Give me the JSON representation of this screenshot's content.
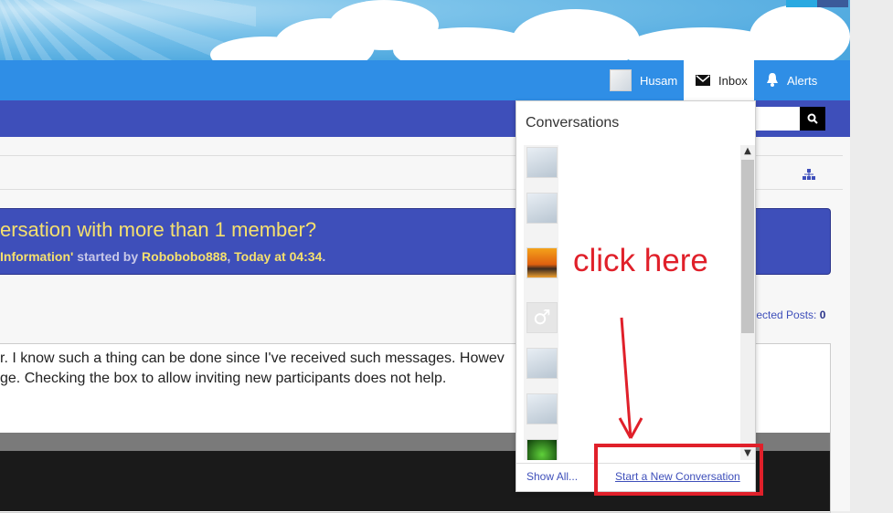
{
  "header": {
    "user_name": "Husam",
    "inbox_label": "Inbox",
    "alerts_label": "Alerts"
  },
  "search": {
    "button_icon": "search-icon"
  },
  "thread": {
    "title": "ersation with more than 1 member?",
    "meta_prefix": "Information'",
    "meta_started_by": " started by ",
    "meta_author": "Robobobo888",
    "meta_sep": ", ",
    "meta_time": "Today at 04:34",
    "meta_end": "."
  },
  "selected_posts": {
    "label": "elected Posts:",
    "count": "0"
  },
  "post": {
    "line1": "r. I know such a thing can be done since I've received such messages. Howev",
    "line2": "ge. Checking the box to allow inviting new participants does not help."
  },
  "popup": {
    "title": "Conversations",
    "avatars": [
      "polar-bear",
      "polar-bear",
      "sunset",
      "male-symbol",
      "polar-bear",
      "polar-bear",
      "green"
    ],
    "show_all": "Show All...",
    "start_new": "Start a New Conversation"
  },
  "annotation": {
    "text": "click here",
    "color": "#e0202a"
  },
  "colors": {
    "nav": "#2f8ee6",
    "subnav": "#3e4fba",
    "title_text": "#f5e06e"
  }
}
